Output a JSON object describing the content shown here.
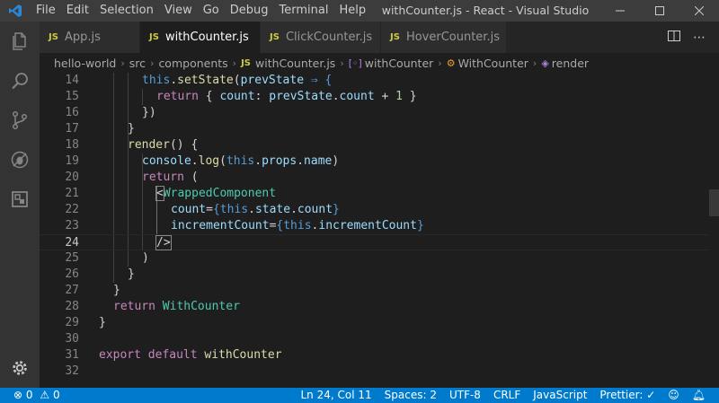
{
  "titlebar": {
    "menu": [
      "File",
      "Edit",
      "Selection",
      "View",
      "Go",
      "Debug",
      "Terminal",
      "Help"
    ],
    "title": "withCounter.js - React - Visual Studio Code"
  },
  "tabs": [
    {
      "badge": "JS",
      "label": "App.js"
    },
    {
      "badge": "JS",
      "label": "withCounter.js"
    },
    {
      "badge": "JS",
      "label": "ClickCounter.js"
    },
    {
      "badge": "JS",
      "label": "HoverCounter.js"
    }
  ],
  "breadcrumb": {
    "parts": [
      "hello-world",
      "src",
      "components"
    ],
    "file": "withCounter.js",
    "symbols": [
      "withCounter",
      "WithCounter",
      "render"
    ]
  },
  "editor": {
    "lines": [
      {
        "n": "14"
      },
      {
        "n": "15"
      },
      {
        "n": "16"
      },
      {
        "n": "17"
      },
      {
        "n": "18"
      },
      {
        "n": "19"
      },
      {
        "n": "20"
      },
      {
        "n": "21"
      },
      {
        "n": "22"
      },
      {
        "n": "23"
      },
      {
        "n": "24"
      },
      {
        "n": "25"
      },
      {
        "n": "26"
      },
      {
        "n": "27"
      },
      {
        "n": "28"
      },
      {
        "n": "29"
      },
      {
        "n": "30"
      },
      {
        "n": "31"
      },
      {
        "n": "32"
      }
    ],
    "tokens": {
      "l14": [
        "this",
        ".",
        "setState",
        "(",
        "prevState",
        " ⇒ {"
      ],
      "l15": [
        "return",
        " { ",
        "count",
        ": ",
        "prevState",
        ".",
        "count",
        " + ",
        "1",
        " }"
      ],
      "l16": [
        "})"
      ],
      "l17": [
        "}"
      ],
      "l18": [
        "render",
        "() {"
      ],
      "l19": [
        "console",
        ".",
        "log",
        "(",
        "this",
        ".",
        "props",
        ".",
        "name",
        ")"
      ],
      "l20": [
        "return",
        " ("
      ],
      "l21": [
        "<",
        "WrappedComponent"
      ],
      "l22": [
        "count",
        "=",
        "{",
        "this",
        ".",
        "state",
        ".",
        "count",
        "}"
      ],
      "l23": [
        "incrementCount",
        "=",
        "{",
        "this",
        ".",
        "incrementCount",
        "}"
      ],
      "l24": [
        "/>"
      ],
      "l25": [
        ")"
      ],
      "l26": [
        "}"
      ],
      "l27": [
        "}"
      ],
      "l28": [
        "return",
        " ",
        "WithCounter"
      ],
      "l29": [
        "}"
      ],
      "l30": [
        ""
      ],
      "l31": [
        "export",
        " ",
        "default",
        " ",
        "withCounter"
      ],
      "l32": [
        ""
      ]
    }
  },
  "statusbar": {
    "errors": "0",
    "warnings": "0",
    "position": "Ln 24, Col 11",
    "spaces": "Spaces: 2",
    "encoding": "UTF-8",
    "eol": "CRLF",
    "language": "JavaScript",
    "prettier": "Prettier: ✓"
  },
  "colors": {
    "statusbar": "#007acc",
    "titlebar": "#3c3c3c",
    "activitybar": "#333333",
    "editor": "#1e1e1e"
  }
}
